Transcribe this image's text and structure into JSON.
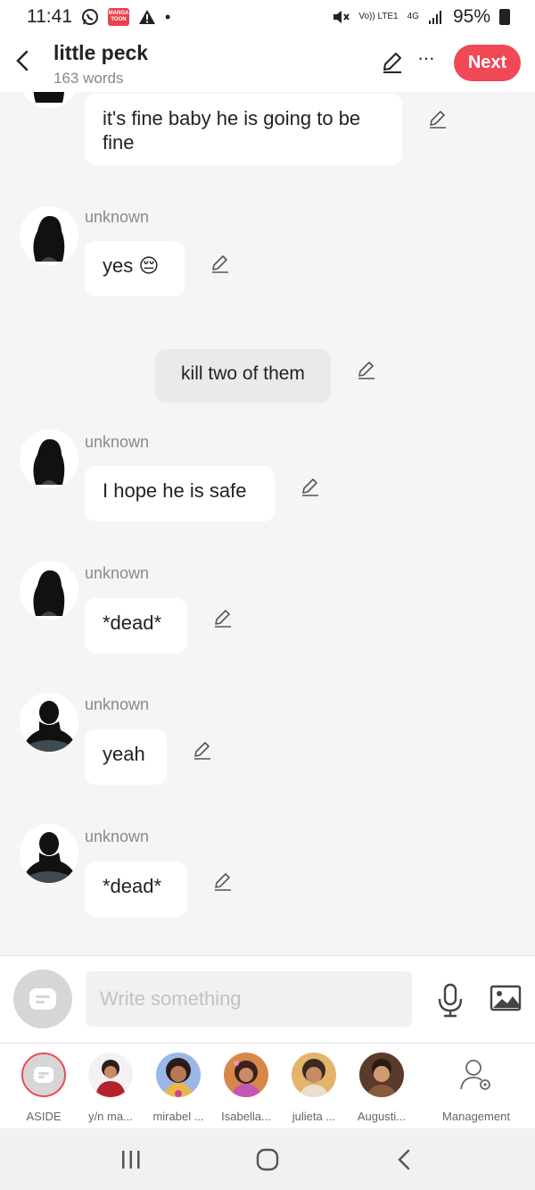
{
  "status_bar": {
    "time": "11:41",
    "manga_badge": "MANGA TOON",
    "alert_icon": "warning-icon",
    "dot": "•",
    "network": "Vo)) LTE1",
    "network_type": "4G",
    "battery": "95%"
  },
  "header": {
    "title": "little peck",
    "subtitle": "163 words",
    "next_label": "Next",
    "more_label": "···"
  },
  "messages": [
    {
      "type": "left",
      "name": "",
      "text_lines": [
        "it's fine baby he is going to be",
        "fine"
      ],
      "avatar": "female-silhouette"
    },
    {
      "type": "left",
      "name": "unknown",
      "text": "yes 😔",
      "avatar": "female-silhouette"
    },
    {
      "type": "center",
      "text": "kill two  of them"
    },
    {
      "type": "left",
      "name": "unknown",
      "text": "I hope he is safe",
      "avatar": "female-silhouette"
    },
    {
      "type": "left",
      "name": "unknown",
      "text": "*dead*",
      "avatar": "female-silhouette"
    },
    {
      "type": "left",
      "name": "unknown",
      "text": "yeah",
      "avatar": "male-silhouette"
    },
    {
      "type": "left",
      "name": "unknown",
      "text": "*dead*",
      "avatar": "male-silhouette"
    }
  ],
  "input": {
    "placeholder": "Write something"
  },
  "characters": [
    {
      "label": "ASIDE"
    },
    {
      "label": "y/n ma..."
    },
    {
      "label": "mirabel ..."
    },
    {
      "label": "Isabella..."
    },
    {
      "label": "julieta ..."
    },
    {
      "label": "Augusti..."
    },
    {
      "label": "Management"
    }
  ],
  "colors": {
    "accent": "#f04854",
    "background": "#f5f5f5",
    "bubble": "#ffffff",
    "aside_bubble": "#eaeaea"
  }
}
